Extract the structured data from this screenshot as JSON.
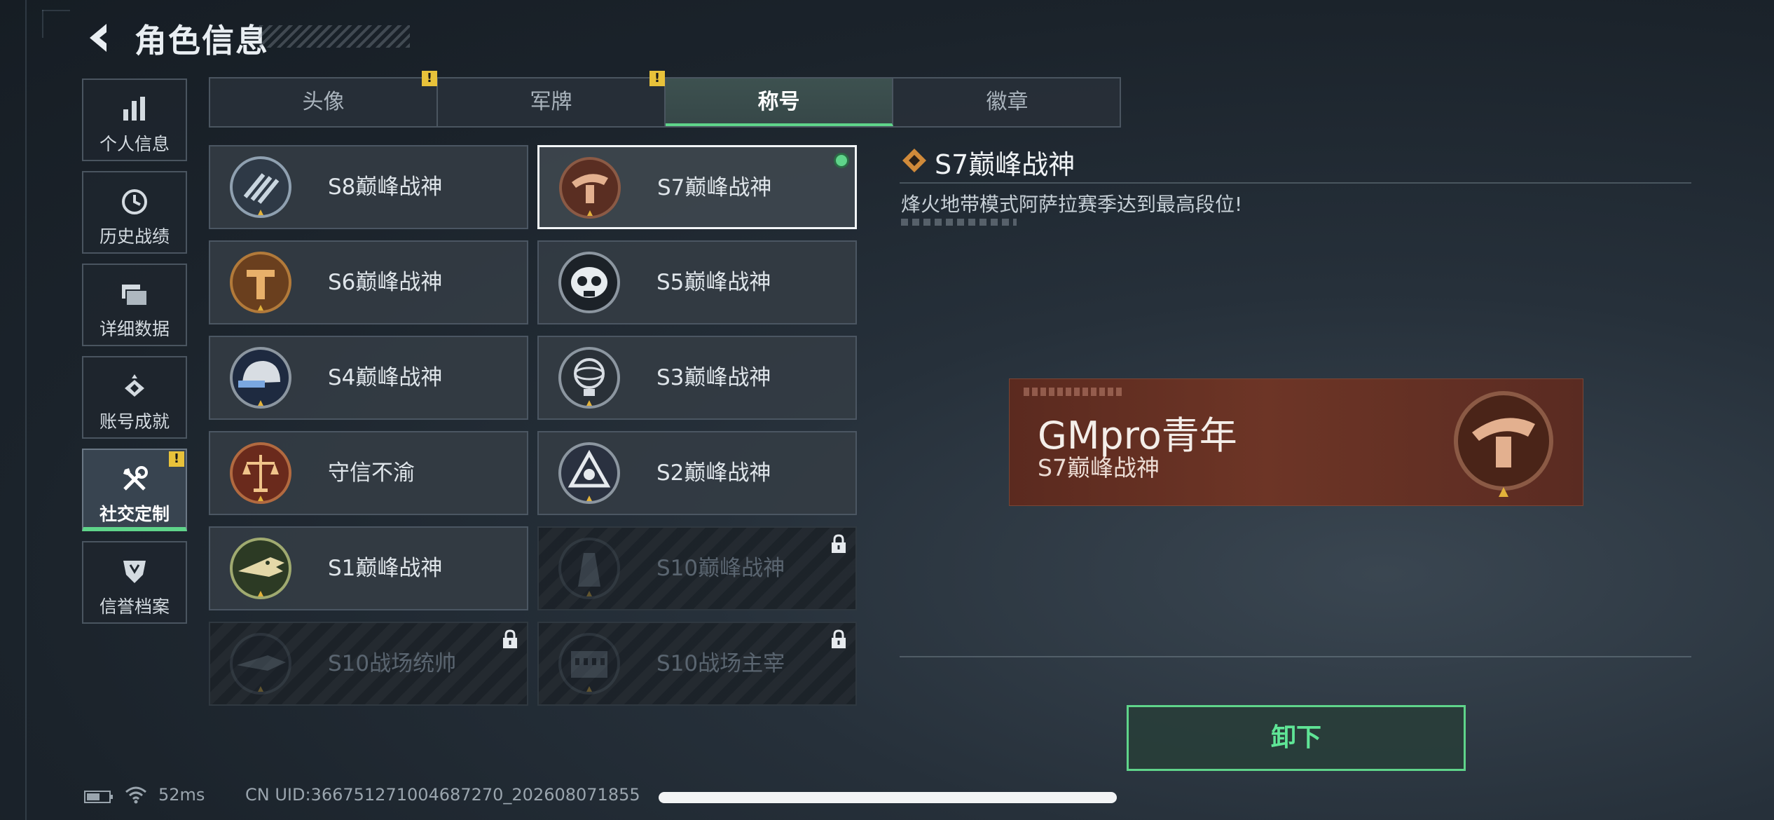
{
  "header": {
    "title": "角色信息"
  },
  "nav": {
    "items": [
      {
        "label": "个人信息"
      },
      {
        "label": "历史战绩"
      },
      {
        "label": "详细数据"
      },
      {
        "label": "账号成就"
      },
      {
        "label": "社交定制",
        "active": true,
        "badge": "!"
      },
      {
        "label": "信誉档案"
      }
    ]
  },
  "tabs": [
    {
      "label": "头像",
      "badge": "!"
    },
    {
      "label": "军牌",
      "badge": "!"
    },
    {
      "label": "称号",
      "active": true
    },
    {
      "label": "徽章"
    }
  ],
  "titles": [
    {
      "label": "S8巅峰战神",
      "emblem": "wings-emblem-icon",
      "locked": false
    },
    {
      "label": "S7巅峰战神",
      "emblem": "crossbow-emblem-icon",
      "locked": false,
      "selected": true,
      "equipped": true
    },
    {
      "label": "S6巅峰战神",
      "emblem": "t-shield-emblem-icon",
      "locked": false
    },
    {
      "label": "S5巅峰战神",
      "emblem": "skull-emblem-icon",
      "locked": false
    },
    {
      "label": "S4巅峰战神",
      "emblem": "helmet-emblem-icon",
      "locked": false
    },
    {
      "label": "S3巅峰战神",
      "emblem": "globe-emblem-icon",
      "locked": false
    },
    {
      "label": "守信不渝",
      "emblem": "scales-emblem-icon",
      "locked": false
    },
    {
      "label": "S2巅峰战神",
      "emblem": "triangle-emblem-icon",
      "locked": false
    },
    {
      "label": "S1巅峰战神",
      "emblem": "crocodile-emblem-icon",
      "locked": false
    },
    {
      "label": "S10巅峰战神",
      "emblem": "tower-emblem-icon",
      "locked": true
    },
    {
      "label": "S10战场统帅",
      "emblem": "shark-emblem-icon",
      "locked": true
    },
    {
      "label": "S10战场主宰",
      "emblem": "colosseum-emblem-icon",
      "locked": true
    }
  ],
  "detail": {
    "title": "S7巅峰战神",
    "description": "烽火地带模式阿萨拉赛季达到最高段位!"
  },
  "banner": {
    "player_name": "GMpro青年",
    "title": "S7巅峰战神"
  },
  "actions": {
    "unequip_label": "卸下"
  },
  "footer": {
    "ping": "52ms",
    "uid": "CN UID:366751271004687270_202608071855"
  },
  "colors": {
    "accent_green": "#5fd48a",
    "warning_yellow": "#e8c23a",
    "banner_bg": "#6d3526"
  }
}
